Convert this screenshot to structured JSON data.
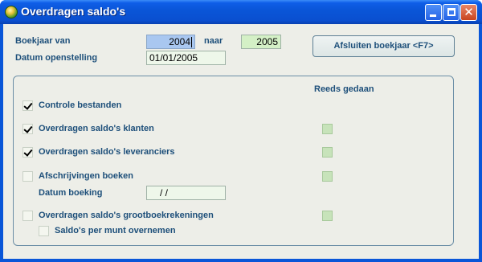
{
  "window": {
    "title": "Overdragen saldo's"
  },
  "header": {
    "boekjaar_label": "Boekjaar van",
    "boekjaar_van": "2004",
    "naar_label": "naar",
    "boekjaar_naar": "2005",
    "datum_opening_label": "Datum openstelling",
    "datum_opening_value": "01/01/2005",
    "close_year_button": "Afsluiten boekjaar <F7>"
  },
  "group": {
    "reeds_gedaan_label": "Reeds gedaan",
    "items": [
      {
        "label": "Controle bestanden",
        "checked": true
      },
      {
        "label": "Overdragen saldo's klanten",
        "checked": true
      },
      {
        "label": "Overdragen saldo's leveranciers",
        "checked": true
      },
      {
        "label": "Afschrijvingen boeken",
        "checked": false
      },
      {
        "label": "Overdragen saldo's grootboekrekeningen",
        "checked": false
      }
    ],
    "datum_boeking_label": "Datum boeking",
    "datum_boeking_value": "/   /",
    "saldo_munt_label": "Saldo's per munt overnemen"
  },
  "colors": {
    "titlebar": "#0a56d8",
    "label_text": "#1d4f7a",
    "client_bg": "#edeee8",
    "done_indicator": "#c7e3ba"
  }
}
